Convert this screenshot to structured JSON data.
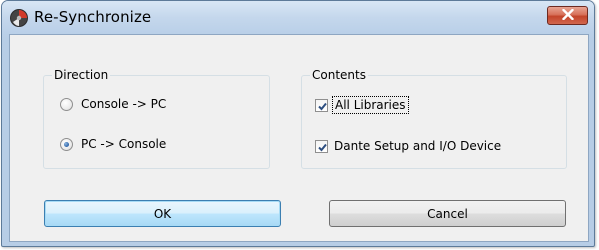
{
  "window": {
    "title": "Re-Synchronize",
    "icon": "app-disc-icon",
    "close_icon": "close-x-icon"
  },
  "direction": {
    "label": "Direction",
    "options": [
      {
        "label": "Console -> PC",
        "selected": false
      },
      {
        "label": "PC -> Console",
        "selected": true
      }
    ]
  },
  "contents": {
    "label": "Contents",
    "options": [
      {
        "label": "All Libraries",
        "checked": true
      },
      {
        "label": "Dante Setup and I/O Device",
        "checked": true
      }
    ]
  },
  "buttons": {
    "ok": "OK",
    "cancel": "Cancel"
  }
}
